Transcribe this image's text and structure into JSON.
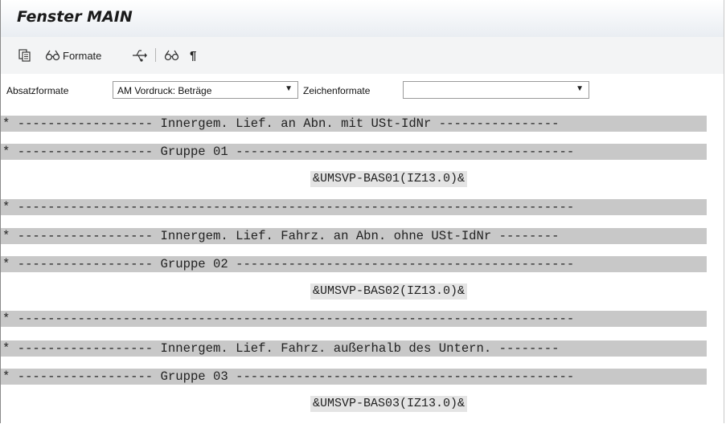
{
  "window": {
    "title": "Fenster MAIN"
  },
  "toolbar": {
    "copy_icon": "copy-icon",
    "formats_label": "Formate",
    "formats_icon": "glasses-icon",
    "transfer_icon": "usb-transfer-icon",
    "view_icon": "glasses-icon",
    "paragraph_mark": "¶"
  },
  "formatbar": {
    "paragraph_label": "Absatzformate",
    "paragraph_value": "AM Vordruck: Beträge",
    "char_label": "Zeichenformate",
    "char_value": "",
    "arrow": "▼"
  },
  "lines": [
    {
      "text": "* ------------------ Innergem. Lief. an Abn. mit USt-IdNr ----------------",
      "style": "grey"
    },
    {
      "text": "* ------------------ Gruppe 01 ---------------------------------------------",
      "style": "grey"
    },
    {
      "text": "&UMSVP-BAS01(IZ13.0)&",
      "style": "var"
    },
    {
      "text": "* --------------------------------------------------------------------------",
      "style": "grey"
    },
    {
      "text": "* ------------------ Innergem. Lief. Fahrz. an Abn. ohne USt-IdNr --------",
      "style": "grey"
    },
    {
      "text": "* ------------------ Gruppe 02 ---------------------------------------------",
      "style": "grey"
    },
    {
      "text": "&UMSVP-BAS02(IZ13.0)&",
      "style": "var"
    },
    {
      "text": "* --------------------------------------------------------------------------",
      "style": "grey"
    },
    {
      "text": "* ------------------ Innergem. Lief. Fahrz. außerhalb des Untern. --------",
      "style": "grey"
    },
    {
      "text": "* ------------------ Gruppe 03 ---------------------------------------------",
      "style": "grey"
    },
    {
      "text": "&UMSVP-BAS03(IZ13.0)&",
      "style": "var"
    }
  ]
}
